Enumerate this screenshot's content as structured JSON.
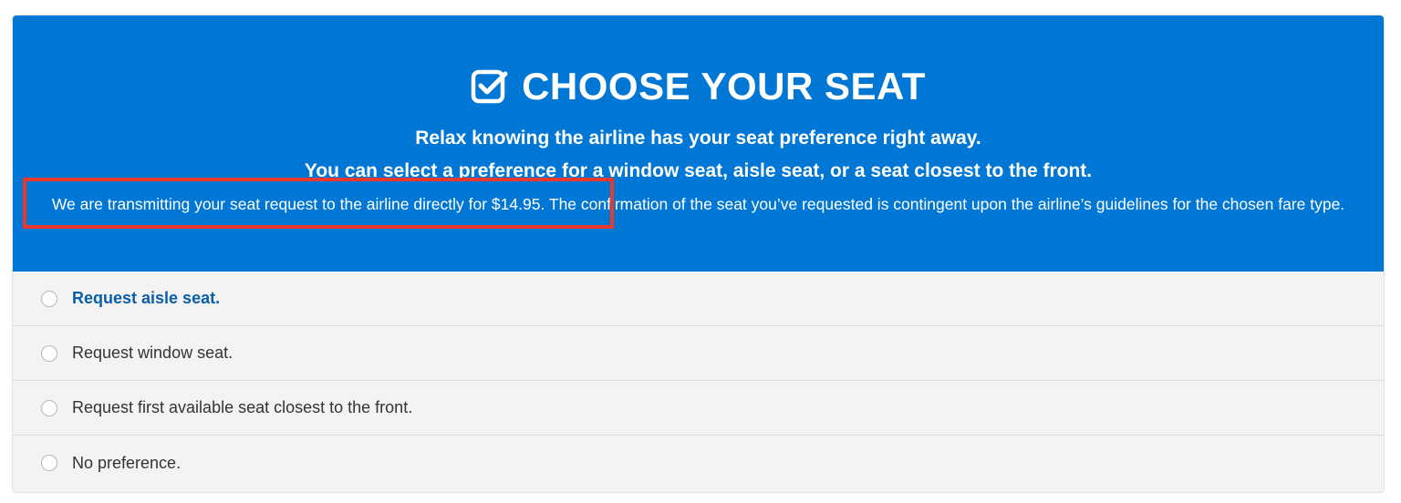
{
  "header": {
    "title": "CHOOSE YOUR SEAT",
    "title_icon": "checkbox-check-icon",
    "subtitle_1": "Relax knowing the airline has your seat preference right away.",
    "subtitle_2": "You can select a preference for a window seat, aisle seat, or a seat closest to the front.",
    "description_highlighted": "We are transmitting your seat request to the airline directly for $14.95.",
    "description_rest": " The confirmation of the seat you’ve requested is contingent upon the airline’s guidelines for the chosen fare type."
  },
  "options": [
    {
      "label": "Request aisle seat.",
      "highlighted": true
    },
    {
      "label": "Request window seat.",
      "highlighted": false
    },
    {
      "label": "Request first available seat closest to the front.",
      "highlighted": false
    },
    {
      "label": "No preference.",
      "highlighted": false
    }
  ],
  "colors": {
    "header_bg": "#0077d4",
    "options_bg": "#f3f3f3",
    "highlight_border": "#e8392c",
    "active_option_text": "#0a5ea8"
  }
}
